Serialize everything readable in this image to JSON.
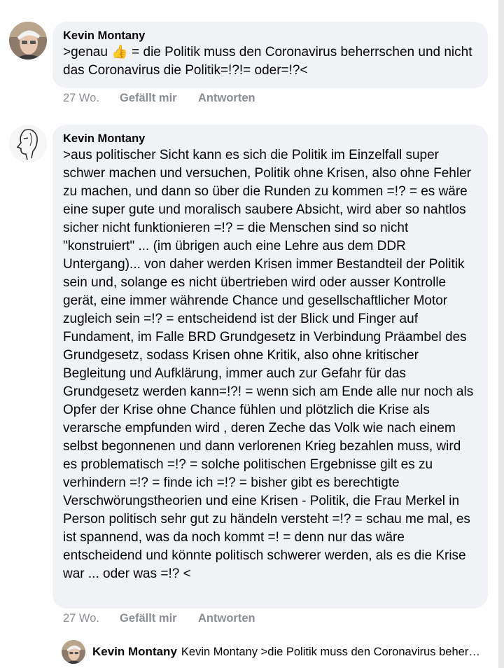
{
  "comments": [
    {
      "author": "Kevin Montany",
      "text": ">genau 👍 = die Politik muss den Coronavirus beherrschen und nicht das Coronavirus die Politik=!?!= oder=!?<",
      "time": "27 Wo.",
      "like_label": "Gefällt mir",
      "reply_label": "Antworten",
      "avatar_icon": "profile-photo-icon"
    },
    {
      "author": "Kevin Montany",
      "text": ">aus politischer Sicht kann es sich die Politik im Einzelfall super schwer machen und versuchen, Politik ohne Krisen, also ohne Fehler zu machen, und dann so über die Runden zu kommen =!? = es wäre eine super gute und moralisch saubere Absicht, wird aber so nahtlos sicher nicht funktionieren =!? = die Menschen sind so nicht \"konstruiert\" ... (im übrigen auch eine Lehre aus dem DDR Untergang)... von daher werden Krisen immer Bestandteil der Politik sein und, solange es nicht übertrieben wird oder ausser Kontrolle gerät, eine immer währende Chance und gesellschaftlicher Motor zugleich sein =!? = entscheidend ist der Blick und Finger auf  Fundament, im Falle BRD Grundgesetz in Verbindung Präambel des Grundgesetz, sodass Krisen ohne Kritik, also ohne kritischer Begleitung und Aufklärung, immer auch zur Gefahr für das Grundgesetz werden kann=!?! = wenn sich am Ende alle nur noch als Opfer der Krise ohne Chance fühlen und plötzlich die Krise als verarsche empfunden wird , deren Zeche das Volk wie nach einem selbst begonnenen und dann  verlorenen Krieg bezahlen muss, wird es problematisch =!? = solche politischen Ergebnisse gilt es zu verhindern =!? = finde ich =!? = bisher gibt es berechtigte Verschwörungstheorien und eine Krisen - Politik, die Frau Merkel in Person politisch sehr gut zu händeln versteht =!? = schau me mal, es ist spannend, was da noch kommt =! = denn nur das wäre entscheidend und könnte politisch schwerer werden, als es die Krise war ... oder was =!? <",
      "time": "27 Wo.",
      "like_label": "Gefällt mir",
      "reply_label": "Antworten",
      "avatar_icon": "sketch-face-icon"
    }
  ],
  "reply_preview": {
    "author": "Kevin Montany",
    "snippet": "Kevin Montany >die Politik muss den Coronavirus beherrschen und nicht das Coronavirus die Politik",
    "avatar_icon": "profile-photo-icon"
  }
}
